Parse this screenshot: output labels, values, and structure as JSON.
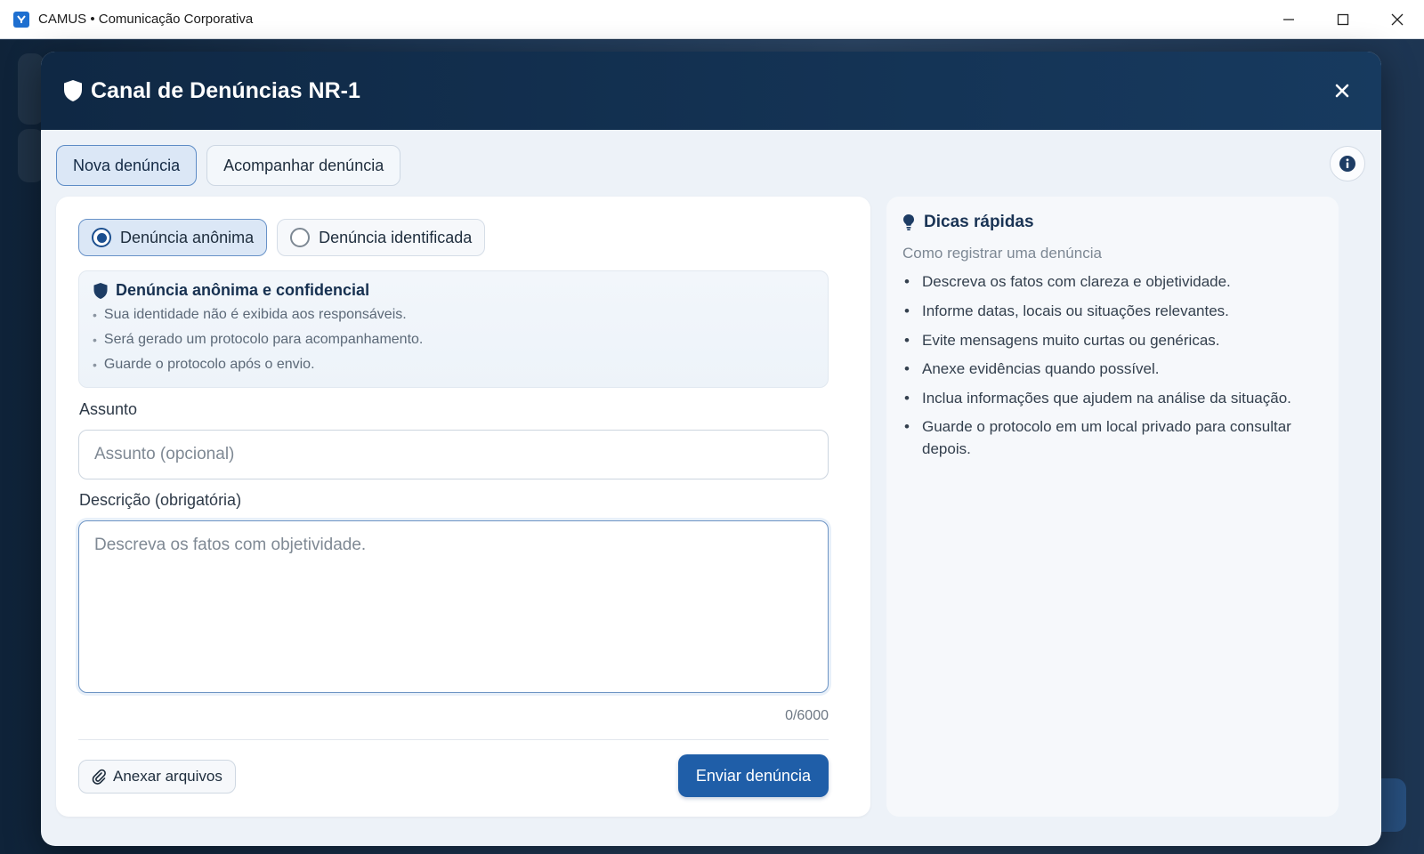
{
  "window": {
    "title": "CAMUS • Comunicação Corporativa",
    "controls": [
      "minimize-icon",
      "maximize-icon",
      "close-icon"
    ]
  },
  "modal": {
    "title": "Canal de Denúncias NR-1",
    "tabs": [
      {
        "label": "Nova denúncia",
        "active": true
      },
      {
        "label": "Acompanhar denúncia",
        "active": false
      }
    ]
  },
  "form": {
    "type_options": [
      {
        "label": "Denúncia anônima",
        "checked": true
      },
      {
        "label": "Denúncia identificada",
        "checked": false
      }
    ],
    "notice": {
      "title": "Denúncia anônima e confidencial",
      "items": [
        "Sua identidade não é exibida aos responsáveis.",
        "Será gerado um protocolo para acompanhamento.",
        "Guarde o protocolo após o envio."
      ]
    },
    "subject_label": "Assunto",
    "subject_placeholder": "Assunto (opcional)",
    "subject_value": "",
    "description_label": "Descrição (obrigatória)",
    "description_placeholder": "Descreva os fatos com objetividade.",
    "description_value": "",
    "counter": "0/6000",
    "attach_label": "Anexar arquivos",
    "submit_label": "Enviar denúncia"
  },
  "tips": {
    "title": "Dicas rápidas",
    "subtitle": "Como registrar uma denúncia",
    "items": [
      "Descreva os fatos com clareza e objetividade.",
      "Informe datas, locais ou situações relevantes.",
      "Evite mensagens muito curtas ou genéricas.",
      "Anexe evidências quando possível.",
      "Inclua informações que ajudem na análise da situação.",
      "Guarde o protocolo em um local privado para consultar depois."
    ]
  },
  "colors": {
    "header": "#0f2844",
    "accent": "#1f5ea8",
    "active_tab": "#dbe7f6",
    "background": "#edf2f8"
  }
}
